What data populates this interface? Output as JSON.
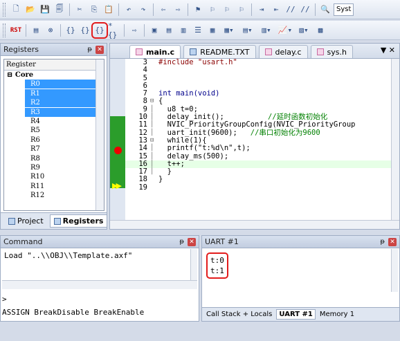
{
  "toolbar1": {
    "buttons": [
      "new-file-icon",
      "open-folder-icon",
      "save-icon",
      "save-all-icon",
      "cut-icon",
      "copy-icon",
      "paste-icon",
      "undo-icon",
      "redo-icon",
      "nav-back-icon",
      "nav-forward-icon",
      "bookmark-icon",
      "bookmark-prev-icon",
      "bookmark-next-icon",
      "bookmark-clear-icon",
      "indent-icon",
      "unindent-icon",
      "comment-icon",
      "uncomment-icon",
      "find-in-files-icon"
    ],
    "target_text": "Syst"
  },
  "toolbar2": {
    "rst_label": "RST"
  },
  "registers_panel": {
    "title": "Registers",
    "pin": "ᵽ",
    "header": "Register",
    "core_label": "Core",
    "registers": [
      "R0",
      "R1",
      "R2",
      "R3",
      "R4",
      "R5",
      "R6",
      "R7",
      "R8",
      "R9",
      "R10",
      "R11",
      "R12"
    ],
    "selected": [
      "R0",
      "R1",
      "R2",
      "R3"
    ],
    "tab_project": "Project",
    "tab_registers": "Registers"
  },
  "editor": {
    "tabs": [
      {
        "label": "main.c",
        "active": true
      },
      {
        "label": "README.TXT",
        "active": false
      },
      {
        "label": "delay.c",
        "active": false
      },
      {
        "label": "sys.h",
        "active": false
      }
    ],
    "tab_menu": "▼ ✕",
    "lines": [
      {
        "n": "3",
        "code": "#include \"usart.h\""
      },
      {
        "n": "4",
        "code": ""
      },
      {
        "n": "5",
        "code": ""
      },
      {
        "n": "6",
        "code": ""
      },
      {
        "n": "7",
        "code": "int main(void)"
      },
      {
        "n": "8",
        "code": "{"
      },
      {
        "n": "9",
        "code": "  u8 t=0;"
      },
      {
        "n": "10",
        "code": "  delay_init();          //延时函数初始化"
      },
      {
        "n": "11",
        "code": "  NVIC_PriorityGroupConfig(NVIC_PriorityGroup"
      },
      {
        "n": "12",
        "code": "  uart_init(9600);   //串口初始化为9600"
      },
      {
        "n": "13",
        "code": "  while(1){"
      },
      {
        "n": "14",
        "code": "  printf(\"t:%d\\n\",t);"
      },
      {
        "n": "15",
        "code": "  delay_ms(500);"
      },
      {
        "n": "16",
        "code": "  t++;"
      },
      {
        "n": "17",
        "code": "  }"
      },
      {
        "n": "18",
        "code": "}"
      },
      {
        "n": "19",
        "code": ""
      }
    ]
  },
  "command_panel": {
    "title": "Command",
    "output": "Load \"..\\\\OBJ\\\\Template.axf\"",
    "prompt": ">",
    "help": "ASSIGN BreakDisable BreakEnable"
  },
  "uart_panel": {
    "title": "UART #1",
    "lines": [
      "t:0",
      "t:1"
    ],
    "tabs": [
      "Call Stack + Locals",
      "UART #1",
      "Memory 1"
    ]
  }
}
